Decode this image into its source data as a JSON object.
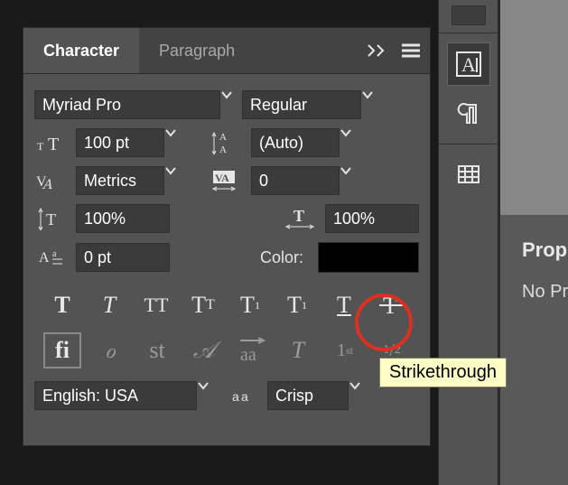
{
  "tabs": {
    "character": "Character",
    "paragraph": "Paragraph"
  },
  "font": {
    "family": "Myriad Pro",
    "style": "Regular"
  },
  "size": "100 pt",
  "leading": "(Auto)",
  "kerning": "Metrics",
  "tracking": "0",
  "vscale": "100%",
  "hscale": "100%",
  "baseline": "0 pt",
  "color_label": "Color:",
  "language": "English: USA",
  "antialias": "Crisp",
  "tooltip": "Strikethrough",
  "props": {
    "title": "Properties",
    "empty": "No Properties"
  },
  "btns": {
    "bold": "T",
    "italic": "T",
    "allcaps": "TT",
    "smallcaps": "T",
    "smallcapsT": "T",
    "super": "T",
    "sub": "T",
    "under": "T",
    "strike": "T",
    "lig": "fi",
    "swash": "ℴ",
    "styl": "st",
    "alt": "𝒜",
    "titling": "aa",
    "italicalt": "T",
    "ord": "1",
    "ord_sfx": "st",
    "frac": "1"
  }
}
